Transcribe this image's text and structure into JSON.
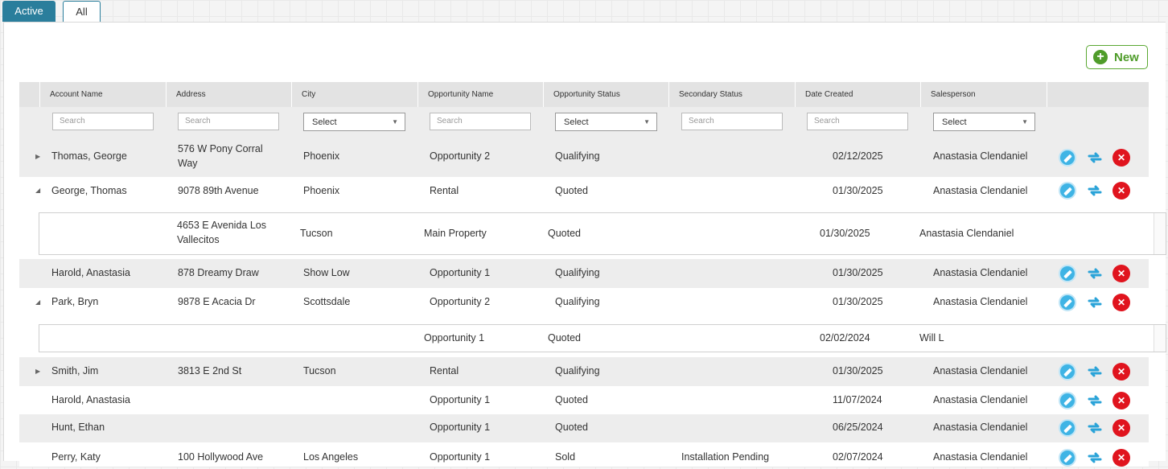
{
  "tabs": [
    {
      "label": "Active"
    },
    {
      "label": "All"
    }
  ],
  "new_button": {
    "label": "New"
  },
  "columns": [
    "Account Name",
    "Address",
    "City",
    "Opportunity Name",
    "Opportunity Status",
    "Secondary Status",
    "Date Created",
    "Salesperson"
  ],
  "filters": {
    "search_placeholder": "Search",
    "select_label": "Select"
  },
  "rows": [
    {
      "account": "Thomas, George",
      "address": "576 W Pony Corral Way",
      "city": "Phoenix",
      "opportunity": "Opportunity 2",
      "status": "Qualifying",
      "secondary": "",
      "date": "02/12/2025",
      "salesperson": "Anastasia Clendaniel"
    },
    {
      "account": "George, Thomas",
      "address": "9078 89th Avenue",
      "city": "Phoenix",
      "opportunity": "Rental",
      "status": "Quoted",
      "secondary": "",
      "date": "01/30/2025",
      "salesperson": "Anastasia Clendaniel"
    },
    {
      "account": "",
      "address": "4653 E Avenida Los Vallecitos",
      "city": "Tucson",
      "opportunity": "Main Property",
      "status": "Quoted",
      "secondary": "",
      "date": "01/30/2025",
      "salesperson": "Anastasia Clendaniel"
    },
    {
      "account": "Harold, Anastasia",
      "address": "878 Dreamy Draw",
      "city": "Show Low",
      "opportunity": "Opportunity 1",
      "status": "Qualifying",
      "secondary": "",
      "date": "01/30/2025",
      "salesperson": "Anastasia Clendaniel"
    },
    {
      "account": "Park, Bryn",
      "address": "9878 E Acacia Dr",
      "city": "Scottsdale",
      "opportunity": "Opportunity 2",
      "status": "Qualifying",
      "secondary": "",
      "date": "01/30/2025",
      "salesperson": "Anastasia Clendaniel"
    },
    {
      "account": "",
      "address": "",
      "city": "",
      "opportunity": "Opportunity 1",
      "status": "Quoted",
      "secondary": "",
      "date": "02/02/2024",
      "salesperson": "Will L"
    },
    {
      "account": "Smith, Jim",
      "address": "3813 E 2nd St",
      "city": "Tucson",
      "opportunity": "Rental",
      "status": "Qualifying",
      "secondary": "",
      "date": "01/30/2025",
      "salesperson": "Anastasia Clendaniel"
    },
    {
      "account": "Harold, Anastasia",
      "address": "",
      "city": "",
      "opportunity": "Opportunity 1",
      "status": "Quoted",
      "secondary": "",
      "date": "11/07/2024",
      "salesperson": "Anastasia Clendaniel"
    },
    {
      "account": "Hunt, Ethan",
      "address": "",
      "city": "",
      "opportunity": "Opportunity 1",
      "status": "Quoted",
      "secondary": "",
      "date": "06/25/2024",
      "salesperson": "Anastasia Clendaniel"
    },
    {
      "account": "Perry, Katy",
      "address": "100 Hollywood Ave",
      "city": "Los Angeles",
      "opportunity": "Opportunity 1",
      "status": "Sold",
      "secondary": "Installation Pending",
      "date": "02/07/2024",
      "salesperson": "Anastasia Clendaniel"
    }
  ],
  "icons": {
    "edit": "edit-pencil-icon",
    "move": "transfer-arrows-icon",
    "delete": "delete-x-icon",
    "expand": "triangle-expand-icon",
    "collapse": "triangle-collapse-icon"
  },
  "colors": {
    "accent": "#2a7e9c",
    "new_green": "#4f9c2a",
    "edit_blue": "#3fb4e5",
    "delete_red": "#e0141e"
  }
}
